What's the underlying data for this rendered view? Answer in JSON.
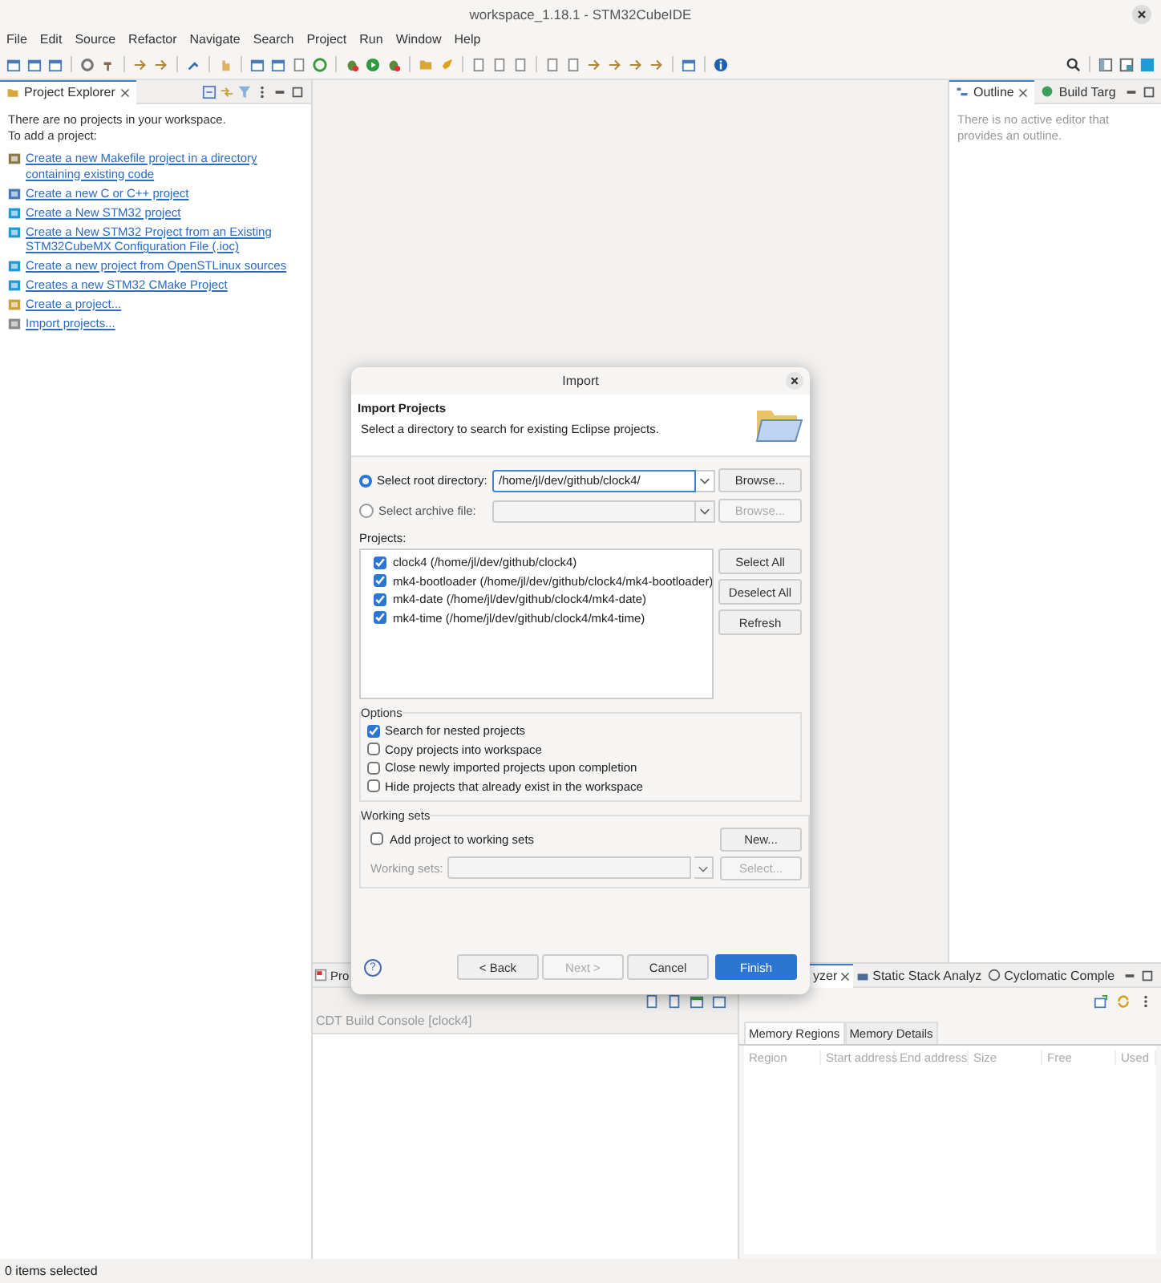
{
  "window": {
    "title": "workspace_1.18.1 - STM32CubeIDE"
  },
  "menu": [
    "File",
    "Edit",
    "Source",
    "Refactor",
    "Navigate",
    "Search",
    "Project",
    "Run",
    "Window",
    "Help"
  ],
  "project_explorer": {
    "tab": "Project Explorer",
    "message": "There are no projects in your workspace.",
    "prompt": "To add a project:",
    "links": [
      {
        "text": "Create a new Makefile project in a directory containing existing code",
        "kind": "makefile"
      },
      {
        "text": "Create a new C or C++ project",
        "kind": "cpp"
      },
      {
        "text": "Create a New STM32 project",
        "kind": "stm32"
      },
      {
        "text": "Create a New STM32 Project from an Existing STM32CubeMX Configuration File (.ioc)",
        "kind": "stm32"
      },
      {
        "text": "Create a new project from OpenSTLinux sources",
        "kind": "stm32"
      },
      {
        "text": "Creates a new STM32 CMake Project",
        "kind": "stm32"
      },
      {
        "text": "Create a project...",
        "kind": "project"
      },
      {
        "text": "Import projects...",
        "kind": "import"
      }
    ]
  },
  "outline": {
    "tabs": [
      {
        "label": "Outline",
        "selected": true
      },
      {
        "label": "Build Targ",
        "selected": false
      }
    ],
    "message": "There is no active editor that provides an outline."
  },
  "console": {
    "tabs": [
      {
        "label": "Pro"
      }
    ],
    "title": "CDT Build Console [clock4]"
  },
  "analyzer": {
    "tabs": [
      {
        "label": "yzer",
        "selected": true
      },
      {
        "label": "Static Stack Analyz",
        "selected": false
      },
      {
        "label": "Cyclomatic Comple",
        "selected": false
      }
    ],
    "subtabs": [
      {
        "label": "Memory Regions",
        "selected": true
      },
      {
        "label": "Memory Details",
        "selected": false
      }
    ],
    "columns": [
      "Region",
      "Start address",
      "End address",
      "Size",
      "Free",
      "Used"
    ]
  },
  "dialog": {
    "title": "Import",
    "heading": "Import Projects",
    "description": "Select a directory to search for existing Eclipse projects.",
    "sources": [
      {
        "label": "Select root directory:",
        "selected": true,
        "value": "/home/jl/dev/github/clock4/",
        "button": "Browse...",
        "disabled": false
      },
      {
        "label": "Select archive file:",
        "selected": false,
        "button": "Browse...",
        "disabled": true
      }
    ],
    "projects_label": "Projects:",
    "projects": [
      {
        "label": "clock4 (/home/jl/dev/github/clock4)",
        "checked": true
      },
      {
        "label": "mk4-bootloader (/home/jl/dev/github/clock4/mk4-bootloader)",
        "checked": true
      },
      {
        "label": "mk4-date (/home/jl/dev/github/clock4/mk4-date)",
        "checked": true
      },
      {
        "label": "mk4-time (/home/jl/dev/github/clock4/mk4-time)",
        "checked": true
      }
    ],
    "project_buttons": [
      "Select All",
      "Deselect All",
      "Refresh"
    ],
    "options": {
      "title": "Options",
      "items": [
        {
          "label": "Search for nested projects",
          "checked": true
        },
        {
          "label": "Copy projects into workspace",
          "checked": false
        },
        {
          "label": "Close newly imported projects upon completion",
          "checked": false
        },
        {
          "label": "Hide projects that already exist in the workspace",
          "checked": false
        }
      ]
    },
    "working_sets": {
      "title": "Working sets",
      "add": {
        "label": "Add project to working sets",
        "checked": false
      },
      "new_button": "New...",
      "field_label": "Working sets:",
      "select_button": "Select..."
    },
    "help": "?",
    "buttons": [
      {
        "label": "< Back",
        "disabled": false,
        "primary": false
      },
      {
        "label": "Next >",
        "disabled": true,
        "primary": false
      },
      {
        "label": "Cancel",
        "disabled": false,
        "primary": false
      },
      {
        "label": "Finish",
        "disabled": false,
        "primary": true
      }
    ]
  },
  "status_bar": "0 items selected"
}
